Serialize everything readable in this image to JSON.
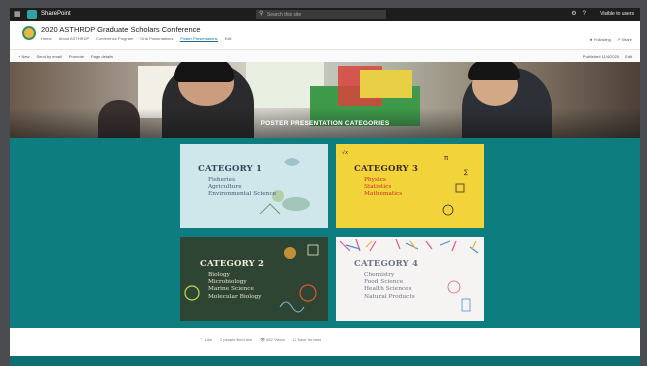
{
  "suite_bar": {
    "app_name": "SharePoint",
    "search_placeholder": "Search this site",
    "user_name": "Visible to users"
  },
  "site": {
    "title": "2020 ASTHRDP Graduate Scholars Conference",
    "nav": [
      "Home",
      "About ASTHRDP",
      "Conference Program",
      "Oral Presentations",
      "Poster Presentations",
      "Edit"
    ],
    "active_nav": "Poster Presentations",
    "follow_label": "Following",
    "share_label": "Share"
  },
  "command_bar": {
    "left": [
      "+ New",
      "Send by email",
      "Promote",
      "Page details"
    ],
    "right": [
      "Published 11/4/2020",
      "Edit"
    ]
  },
  "hero": {
    "title": "POSTER PRESENTATION CATEGORIES"
  },
  "categories": [
    {
      "title": "CATEGORY 1",
      "items": [
        "Fisheries",
        "Agriculture",
        "Environmental Science"
      ]
    },
    {
      "title": "CATEGORY 3",
      "items": [
        "Physics",
        "Statistics",
        "Mathematics"
      ]
    },
    {
      "title": "CATEGORY 2",
      "items": [
        "Biology",
        "Microbiology",
        "Marine Science",
        "Molecular Biology"
      ]
    },
    {
      "title": "CATEGORY 4",
      "items": [
        "Chemistry",
        "Food Science",
        "Health Sciences",
        "Natural Products"
      ]
    }
  ],
  "footer": {
    "like": "Like",
    "comments": "2 people liked this",
    "views": "852 Views",
    "save": "Save for later"
  },
  "colors": {
    "panel_teal": "#0d7d7f",
    "suite_bar": "#1d1d1d"
  }
}
